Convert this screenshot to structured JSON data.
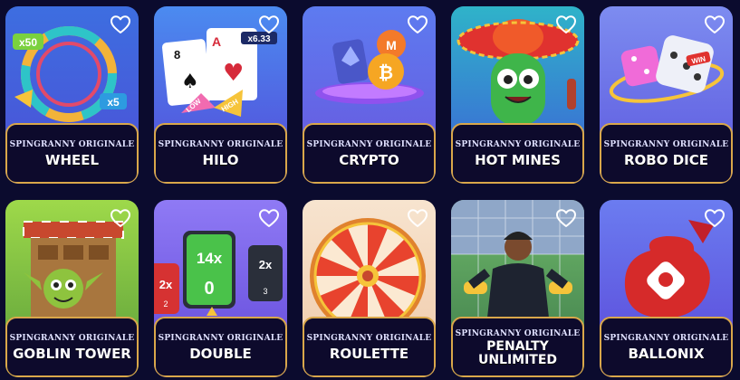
{
  "games": [
    {
      "brand": "SPINGRANNY ORIGINALE",
      "name": "WHEEL",
      "art": "wheel",
      "bg": [
        "#3d6ee0",
        "#4d4fd6"
      ],
      "art_texts": [
        "x50",
        "x5"
      ],
      "favorite": false
    },
    {
      "brand": "SPINGRANNY ORIGINALE",
      "name": "HILO",
      "art": "hilo",
      "bg": [
        "#4b8bf0",
        "#5548d8"
      ],
      "art_texts": [
        "8",
        "A",
        "x6.33",
        "LOW",
        "HIGH"
      ],
      "favorite": false
    },
    {
      "brand": "SPINGRANNY ORIGINALE",
      "name": "CRYPTO",
      "art": "crypto",
      "bg": [
        "#5d7bf0",
        "#6a55dd"
      ],
      "art_texts": [],
      "favorite": false
    },
    {
      "brand": "SPINGRANNY ORIGINALE",
      "name": "HOT MINES",
      "art": "hotmines",
      "bg": [
        "#2fb3c9",
        "#3d5ed8"
      ],
      "art_texts": [],
      "favorite": false
    },
    {
      "brand": "SPINGRANNY ORIGINALE",
      "name": "ROBO DICE",
      "art": "robodice",
      "bg": [
        "#7d8cf0",
        "#5b57de"
      ],
      "art_texts": [
        "WIN"
      ],
      "favorite": false
    },
    {
      "brand": "SPINGRANNY ORIGINALE",
      "name": "GOBLIN TOWER",
      "art": "goblin",
      "bg": [
        "#9ed94a",
        "#5a9d3a"
      ],
      "art_texts": [],
      "favorite": false
    },
    {
      "brand": "SPINGRANNY ORIGINALE",
      "name": "DOUBLE",
      "art": "double",
      "bg": [
        "#8f7af5",
        "#6148d8"
      ],
      "art_texts": [
        "14x",
        "0",
        "2x",
        "2x",
        "2",
        "3"
      ],
      "favorite": false
    },
    {
      "brand": "SPINGRANNY ORIGINALE",
      "name": "ROULETTE",
      "art": "roulette",
      "bg": [
        "#f7e4cf",
        "#f0c9a8"
      ],
      "art_texts": [],
      "favorite": false
    },
    {
      "brand": "SPINGRANNY ORIGINALE",
      "name": "PENALTY\nUNLIMITED",
      "art": "penalty",
      "bg": [
        "#6fb86a",
        "#3d7a4a"
      ],
      "art_texts": [],
      "favorite": false
    },
    {
      "brand": "SPINGRANNY ORIGINALE",
      "name": "BALLONIX",
      "art": "ballonix",
      "bg": [
        "#6b7cf0",
        "#5a47d8"
      ],
      "art_texts": [],
      "favorite": false
    }
  ],
  "colors": {
    "page_bg": "#0b0b2e",
    "plate_bg": "#0d0a2c",
    "plate_border": "#d9a74a",
    "heart": "#ffffff"
  },
  "icons": {
    "favorite": "heart-outline-icon"
  }
}
